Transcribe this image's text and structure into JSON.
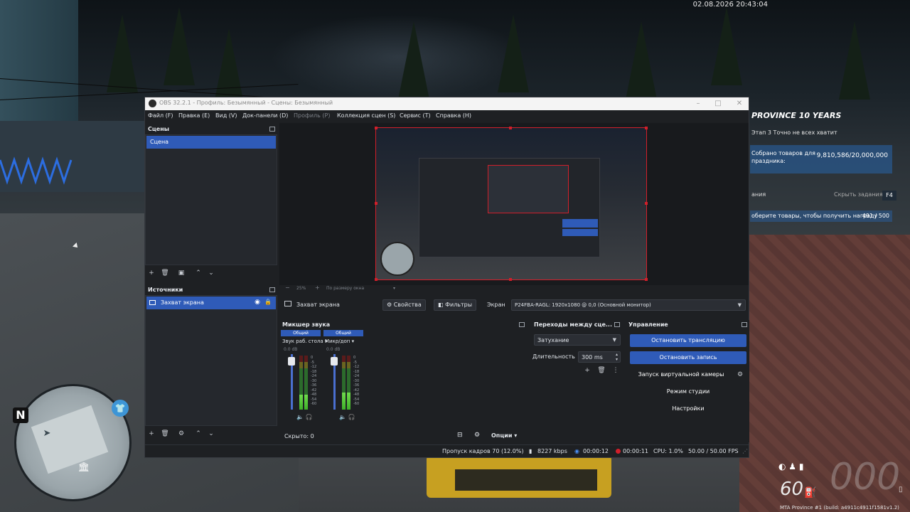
{
  "hud": {
    "datetime": "02.08.2026 20:43:04",
    "quest": {
      "title": "PROVINCE 10 YEARS",
      "subtitle": "Этап 3  Точно не всех хватит",
      "collected_label": "Собрано товаров для праздника:",
      "collected_value": "9,810,586/20,000,000",
      "tasks_label": "ания",
      "hide_tasks": "Скрыть задания",
      "hide_key": "F4",
      "task_text": "оберите товары, чтобы получить награду",
      "task_progress": "491 / 500"
    },
    "minimap": {
      "north": "N"
    },
    "speed": {
      "value": "60",
      "bg": "000"
    },
    "build": "MTA Province #1 (build: a4911c4911f1581v1.2)"
  },
  "obs": {
    "title": "OBS 32.2.1 - Профиль: Безымянный - Сцены: Безымянный",
    "menu": [
      {
        "label": "Файл (F)",
        "disabled": false
      },
      {
        "label": "Правка (E)",
        "disabled": false
      },
      {
        "label": "Вид (V)",
        "disabled": false
      },
      {
        "label": "Док-панели (D)",
        "disabled": false
      },
      {
        "label": "Профиль (P)",
        "disabled": true
      },
      {
        "label": "Коллекция сцен (S)",
        "disabled": false
      },
      {
        "label": "Сервис (T)",
        "disabled": false
      },
      {
        "label": "Справка (H)",
        "disabled": false
      }
    ],
    "scenes": {
      "title": "Сцены",
      "items": [
        "Сцена"
      ]
    },
    "sources": {
      "title": "Источники",
      "items": [
        "Захват экрана"
      ]
    },
    "preview": {
      "zoom": "25%",
      "fit_label": "По размеру окна"
    },
    "source_bar": {
      "name": "Захват экрана",
      "properties": "Свойства",
      "filters": "Фильтры",
      "screen_label": "Экран",
      "screen_value": "P24FBA-RAGL: 1920x1080 @ 0,0 (Основной монитор)"
    },
    "mixer": {
      "title": "Микшер звука",
      "channels": [
        {
          "head": "Общий",
          "name": "Звук раб. стола",
          "db": "0.0 dB",
          "level": 0.28
        },
        {
          "head": "Общий",
          "name": "Микр/доп",
          "db": "0.0 dB",
          "level": 0.32
        }
      ],
      "scale": [
        "0",
        "-5",
        "-12",
        "-18",
        "-24",
        "-30",
        "-36",
        "-42",
        "-48",
        "-54",
        "-60"
      ],
      "hidden": "Скрыто: 0",
      "options": "Опции"
    },
    "transitions": {
      "title": "Переходы между сце...",
      "type": "Затухание",
      "duration_label": "Длительность",
      "duration_value": "300 ms"
    },
    "controls": {
      "title": "Управление",
      "stop_stream": "Остановить трансляцию",
      "stop_record": "Остановить запись",
      "virtual_cam": "Запуск виртуальной камеры",
      "studio_mode": "Режим студии",
      "settings": "Настройки"
    },
    "status": {
      "dropped": "Пропуск кадров 70 (12.0%)",
      "bitrate": "8227 kbps",
      "stream_time": "00:00:12",
      "rec_time": "00:00:11",
      "cpu": "CPU: 1.0%",
      "fps": "50.00 / 50.00 FPS"
    }
  }
}
